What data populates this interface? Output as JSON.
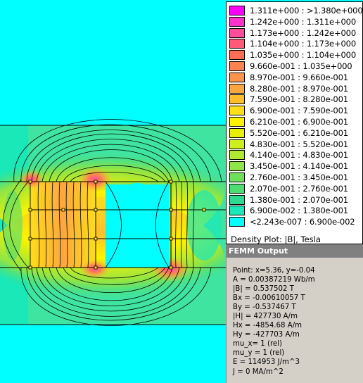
{
  "legend": {
    "rows": [
      {
        "label": "1.311e+000 : >1.380e+000",
        "color": "#ff00ff"
      },
      {
        "label": "1.242e+000 : 1.311e+000",
        "color": "#ff33cc"
      },
      {
        "label": "1.173e+000 : 1.242e+000",
        "color": "#ff4d99"
      },
      {
        "label": "1.104e+000 : 1.173e+000",
        "color": "#ff5a78"
      },
      {
        "label": "1.035e+000 : 1.104e+000",
        "color": "#ff6d55"
      },
      {
        "label": "9.660e-001 : 1.035e+000",
        "color": "#ff8250"
      },
      {
        "label": "8.970e-001 : 9.660e-001",
        "color": "#ff944a"
      },
      {
        "label": "8.280e-001 : 8.970e-001",
        "color": "#ffa640"
      },
      {
        "label": "7.590e-001 : 8.280e-001",
        "color": "#ffbd2e"
      },
      {
        "label": "6.900e-001 : 7.590e-001",
        "color": "#ffde1a"
      },
      {
        "label": "6.210e-001 : 6.900e-001",
        "color": "#fff200"
      },
      {
        "label": "5.520e-001 : 6.210e-001",
        "color": "#e8f000"
      },
      {
        "label": "4.830e-001 : 5.520e-001",
        "color": "#cdef1e"
      },
      {
        "label": "4.140e-001 : 4.830e-001",
        "color": "#aee830"
      },
      {
        "label": "3.450e-001 : 4.140e-001",
        "color": "#8ee545"
      },
      {
        "label": "2.760e-001 : 3.450e-001",
        "color": "#6fe05a"
      },
      {
        "label": "2.070e-001 : 2.760e-001",
        "color": "#4ddc70"
      },
      {
        "label": "1.380e-001 : 2.070e-001",
        "color": "#2ed88f"
      },
      {
        "label": "6.900e-002 : 1.380e-001",
        "color": "#1ae8b8"
      },
      {
        "label": "<2.243e-007 : 6.900e-002",
        "color": "#00ffff"
      }
    ],
    "caption": "Density Plot: |B|, Tesla"
  },
  "output": {
    "title": "FEMM Output",
    "lines": [
      "Point: x=5.36, y=-0.04",
      "A    = 0.00387219 Wb/m",
      "|B| = 0.537502 T",
      "Bx  = -0.00610057 T",
      "By  = -0.537467 T",
      "|H| = 427730 A/m",
      "Hx  = -4854.68 A/m",
      "Hy  = -427703 A/m",
      "mu_x= 1 (rel)",
      "mu_y = 1 (rel)",
      "E    = 114953 J/m^3",
      "J    = 0 MA/m^2"
    ]
  }
}
